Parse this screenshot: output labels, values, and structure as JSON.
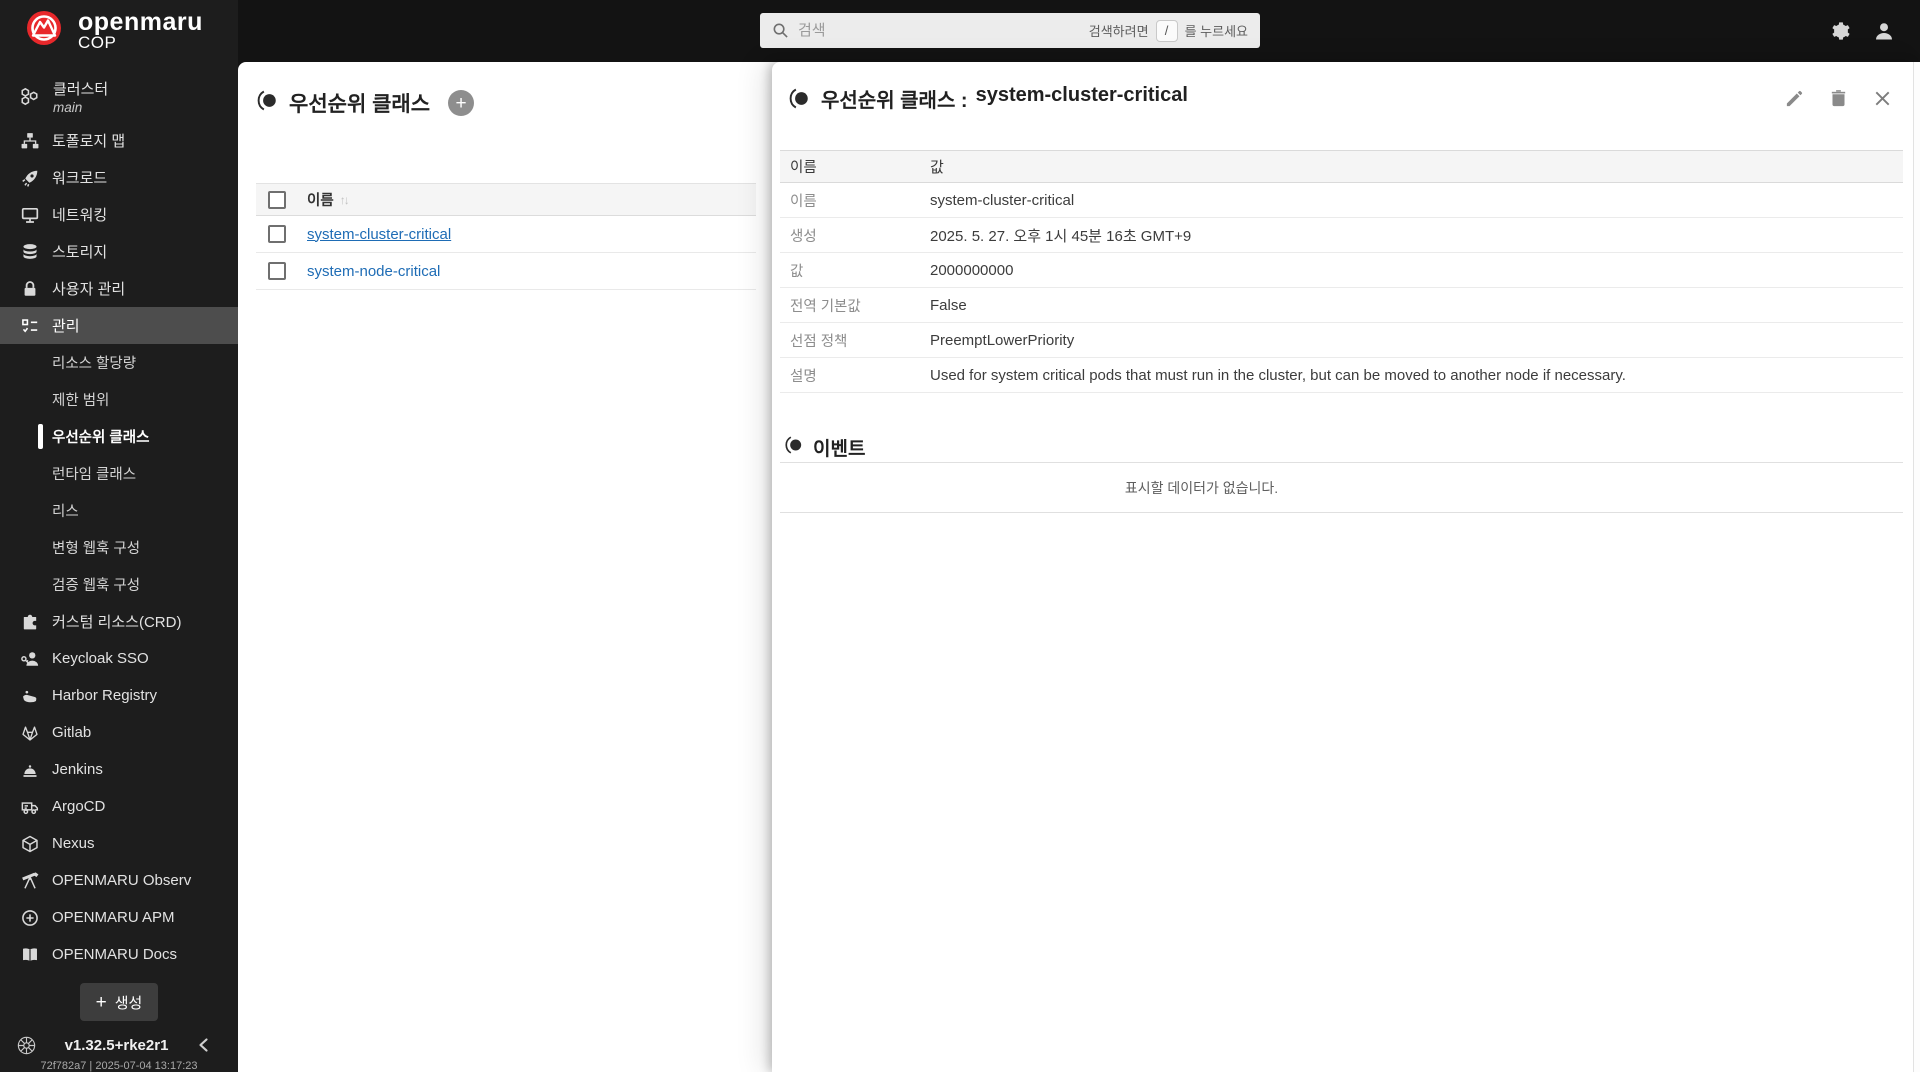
{
  "topbar": {
    "logo": {
      "title": "openmaru",
      "subtitle": "COP",
      "icon": "openmaru-logo-icon"
    },
    "search": {
      "placeholder": "검색",
      "icon": "search-icon",
      "hint_prefix": "검색하려면",
      "hint_key": "/",
      "hint_suffix": "를 누르세요"
    },
    "action_icons": [
      "gear-icon",
      "user-icon"
    ]
  },
  "sidebar": {
    "cluster": {
      "label": "클러스터",
      "name": "main",
      "icon": "cluster-icon"
    },
    "items": [
      {
        "label": "토폴로지 맵",
        "icon": "topology-map-icon"
      },
      {
        "label": "워크로드",
        "icon": "rocket-icon"
      },
      {
        "label": "네트워킹",
        "icon": "network-icon"
      },
      {
        "label": "스토리지",
        "icon": "database-icon"
      },
      {
        "label": "사용자 관리",
        "icon": "lock-icon"
      },
      {
        "label": "관리",
        "icon": "checklist-icon",
        "selected": true
      }
    ],
    "management_children": [
      {
        "label": "리소스 할당량"
      },
      {
        "label": "제한 범위"
      },
      {
        "label": "우선순위 클래스",
        "active": true
      },
      {
        "label": "런타임 클래스"
      },
      {
        "label": "리스"
      },
      {
        "label": "변형 웹훅 구성"
      },
      {
        "label": "검증 웹훅 구성"
      }
    ],
    "integrations": [
      {
        "label": "커스텀 리소스(CRD)",
        "icon": "puzzle-icon"
      },
      {
        "label": "Keycloak SSO",
        "icon": "key-user-icon"
      },
      {
        "label": "Harbor Registry",
        "icon": "helm-boat-icon"
      },
      {
        "label": "Gitlab",
        "icon": "gitlab-fox-icon"
      },
      {
        "label": "Jenkins",
        "icon": "bell-icon"
      },
      {
        "label": "ArgoCD",
        "icon": "truck-icon"
      },
      {
        "label": "Nexus",
        "icon": "cube-icon"
      },
      {
        "label": "OPENMARU Observ",
        "icon": "telescope-icon"
      },
      {
        "label": "OPENMARU APM",
        "icon": "plus-circle-icon"
      },
      {
        "label": "OPENMARU Docs",
        "icon": "book-icon"
      }
    ],
    "create_button": "생성",
    "version": "v1.32.5+rke2r1",
    "build_info": "72f782a7 | 2025-07-04 13:17:23",
    "footer_icons": [
      "kubernetes-icon",
      "chevron-left-icon"
    ]
  },
  "list_panel": {
    "title": "우선순위 클래스",
    "add_button_icon": "plus-icon",
    "columns": {
      "name": "이름"
    },
    "sort_icon": "↑↓",
    "rows": [
      {
        "name": "system-cluster-critical"
      },
      {
        "name": "system-node-critical"
      }
    ]
  },
  "detail_panel": {
    "title_prefix": "우선순위 클래스 :",
    "title_resource": "system-cluster-critical",
    "action_icons": [
      "pencil-icon",
      "trash-icon",
      "close-icon"
    ],
    "table": {
      "header": {
        "name": "이름",
        "value": "값"
      },
      "rows": [
        {
          "label": "이름",
          "value": "system-cluster-critical"
        },
        {
          "label": "생성",
          "value": "2025. 5. 27. 오후 1시 45분 16초 GMT+9"
        },
        {
          "label": "값",
          "value": "2000000000"
        },
        {
          "label": "전역 기본값",
          "value": "False"
        },
        {
          "label": "선점 정책",
          "value": "PreemptLowerPriority"
        },
        {
          "label": "설명",
          "value": "Used for system critical pods that must run in the cluster, but can be moved to another node if necessary."
        }
      ]
    },
    "events": {
      "title": "이벤트",
      "empty_message": "표시할 데이터가 없습니다."
    }
  },
  "colors": {
    "topbar_bg": "#131313",
    "sidebar_bg": "#1d1d1d",
    "sidebar_selected_bg": "#4d4d4d",
    "brand_red": "#e8282b",
    "link_blue": "#1e6cb5",
    "table_header_bg": "#f5f5f5"
  }
}
